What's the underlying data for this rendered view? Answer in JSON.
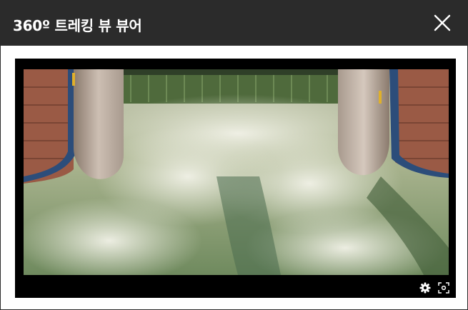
{
  "window": {
    "title": "360º 트레킹 뷰 뷰어"
  },
  "icons": {
    "close": "close-icon",
    "settings": "gear-icon",
    "fullscreen": "fullscreen-icon"
  },
  "colors": {
    "titlebar": "#2b2b2b",
    "title_text": "#ffffff",
    "player_bg": "#000000"
  },
  "video": {
    "description_image": "dam-spillway-photo"
  }
}
